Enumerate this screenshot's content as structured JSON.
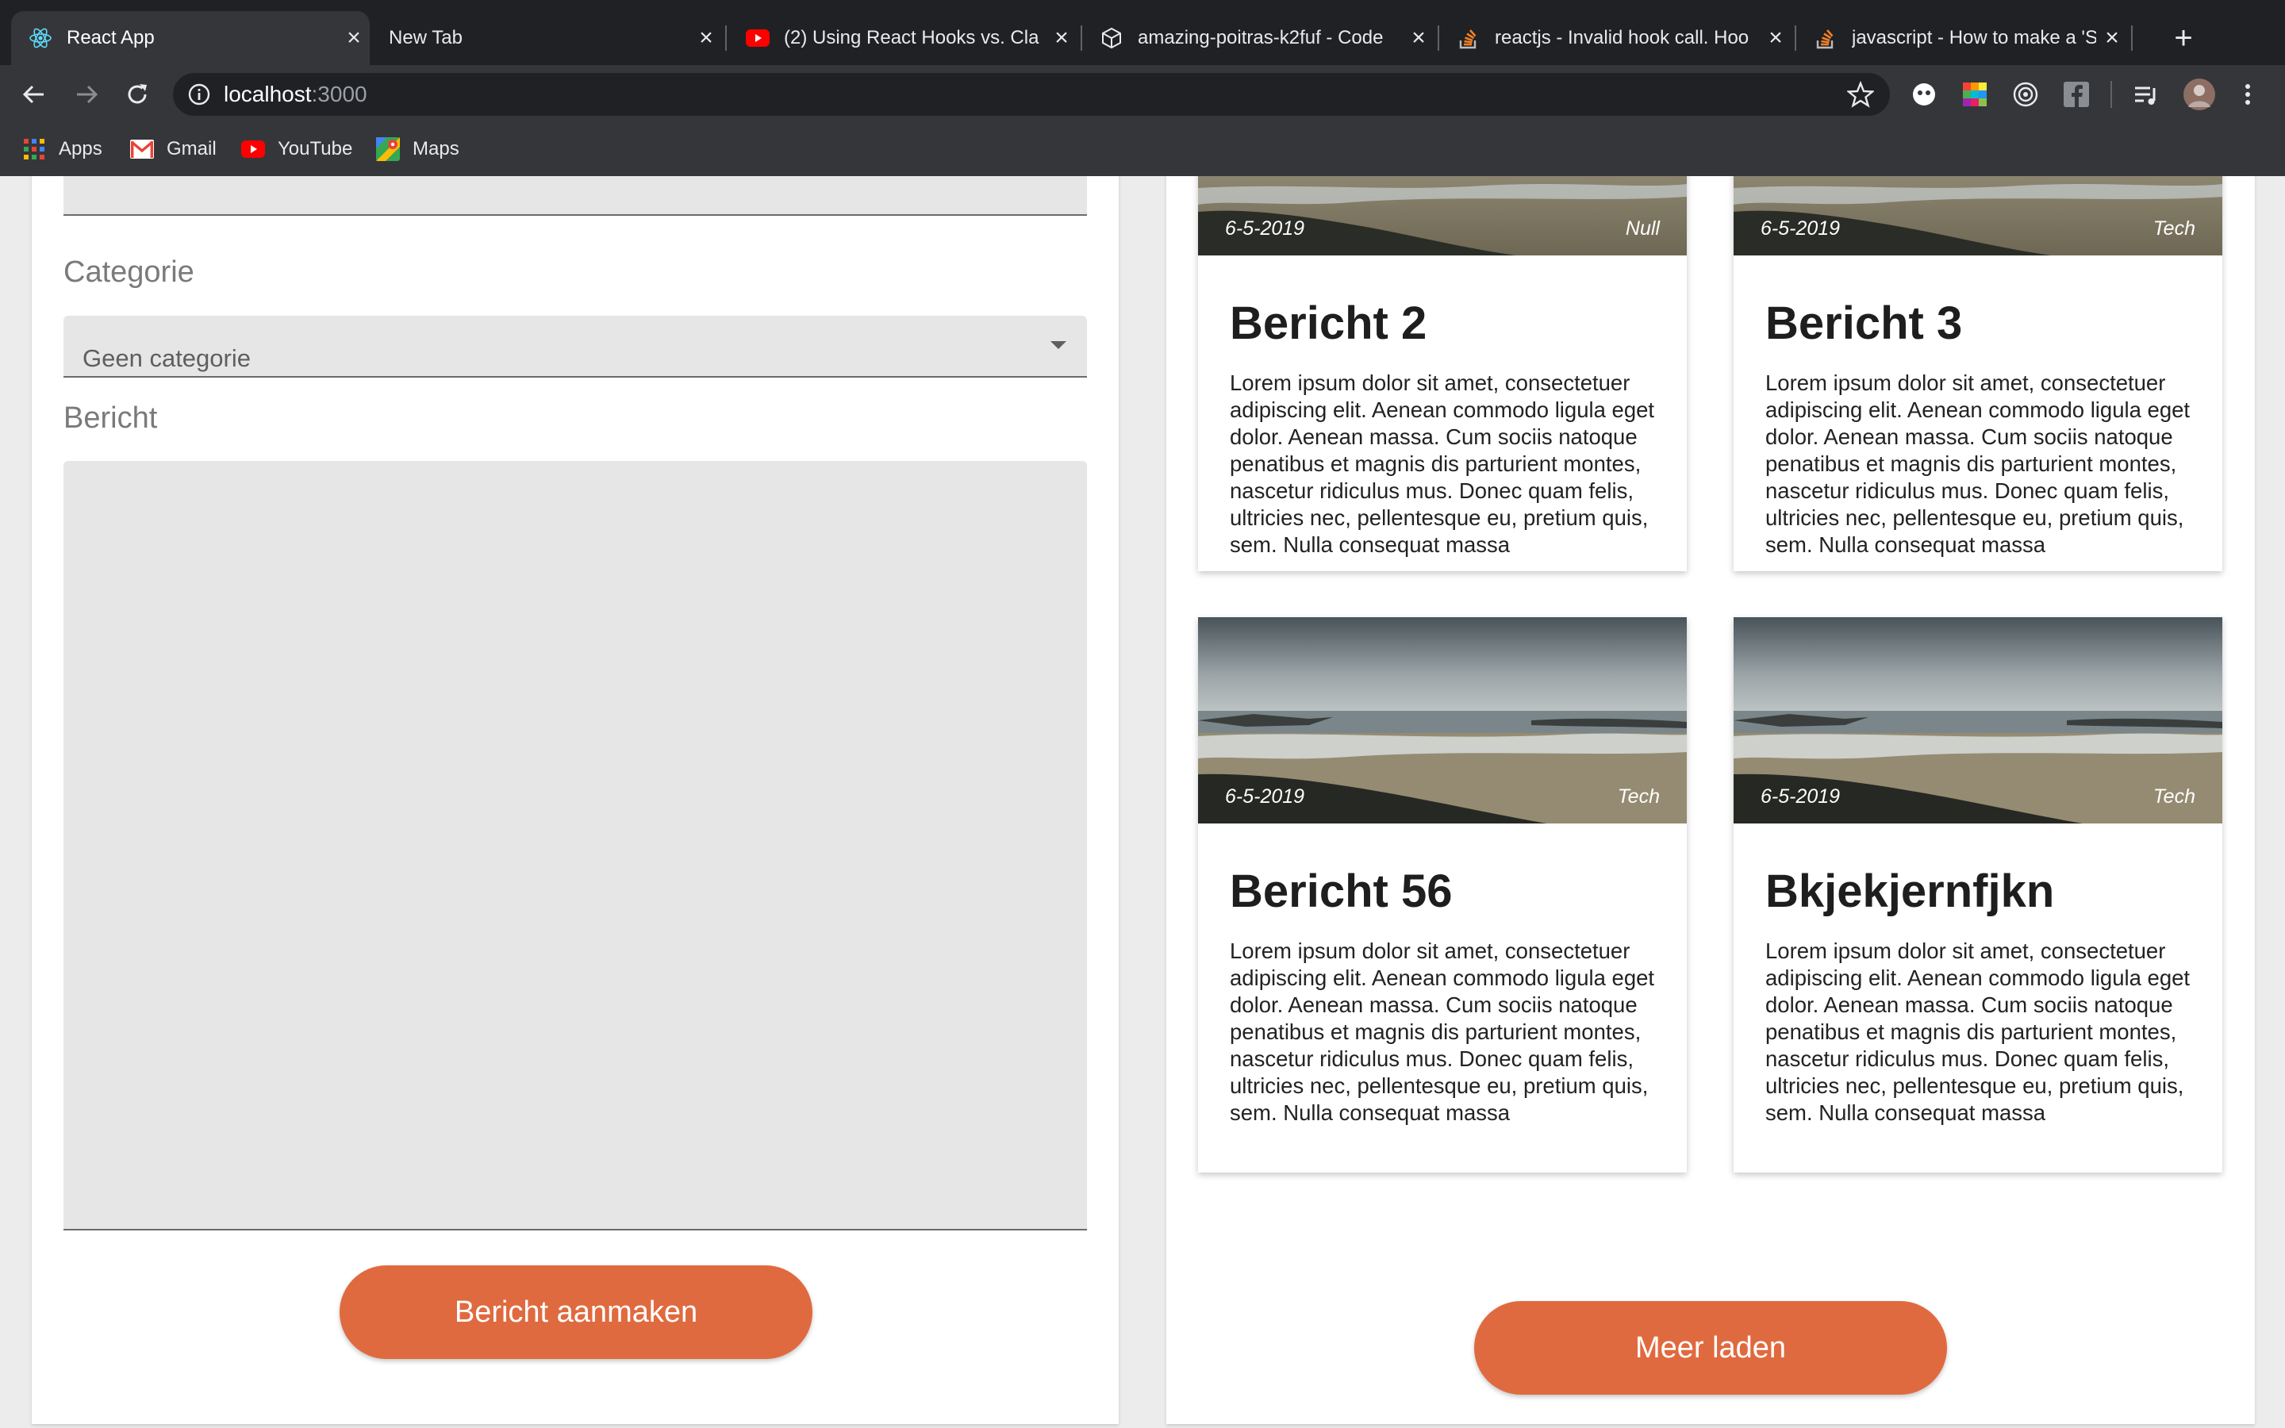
{
  "browser": {
    "tabs": [
      {
        "title": "React App",
        "icon": "react-icon",
        "active": true
      },
      {
        "title": "New Tab",
        "icon": "",
        "active": false
      },
      {
        "title": "(2) Using React Hooks vs. Cla",
        "icon": "youtube-icon",
        "active": false
      },
      {
        "title": "amazing-poitras-k2fuf - Code",
        "icon": "codesandbox-icon",
        "active": false
      },
      {
        "title": "reactjs - Invalid hook call. Hoo",
        "icon": "stackoverflow-icon",
        "active": false
      },
      {
        "title": "javascript - How to make a 'Se",
        "icon": "stackoverflow-icon",
        "active": false
      }
    ],
    "url": {
      "host": "localhost",
      "port": ":3000"
    },
    "bookmarks": [
      {
        "label": "Apps",
        "icon": "apps-grid-icon"
      },
      {
        "label": "Gmail",
        "icon": "gmail-icon"
      },
      {
        "label": "YouTube",
        "icon": "youtube-icon"
      },
      {
        "label": "Maps",
        "icon": "maps-icon"
      }
    ]
  },
  "form": {
    "category_label": "Categorie",
    "category_value": "Geen categorie",
    "message_label": "Bericht",
    "message_value": "",
    "submit_label": "Bericht aanmaken"
  },
  "posts": [
    {
      "title": "Bericht 2",
      "date": "6-5-2019",
      "category": "Null",
      "body": "Lorem ipsum dolor sit amet, consectetuer adipiscing elit. Aenean commodo ligula eget dolor. Aenean massa. Cum sociis natoque penatibus et magnis dis parturient montes, nascetur ridiculus mus. Donec quam felis, ultricies nec, pellentesque eu, pretium quis, sem. Nulla consequat massa"
    },
    {
      "title": "Bericht 3",
      "date": "6-5-2019",
      "category": "Tech",
      "body": "Lorem ipsum dolor sit amet, consectetuer adipiscing elit. Aenean commodo ligula eget dolor. Aenean massa. Cum sociis natoque penatibus et magnis dis parturient montes, nascetur ridiculus mus. Donec quam felis, ultricies nec, pellentesque eu, pretium quis, sem. Nulla consequat massa"
    },
    {
      "title": "Bericht 56",
      "date": "6-5-2019",
      "category": "Tech",
      "body": "Lorem ipsum dolor sit amet, consectetuer adipiscing elit. Aenean commodo ligula eget dolor. Aenean massa. Cum sociis natoque penatibus et magnis dis parturient montes, nascetur ridiculus mus. Donec quam felis, ultricies nec, pellentesque eu, pretium quis, sem. Nulla consequat massa"
    },
    {
      "title": "Bkjekjernfjkn",
      "date": "6-5-2019",
      "category": "Tech",
      "body": "Lorem ipsum dolor sit amet, consectetuer adipiscing elit. Aenean commodo ligula eget dolor. Aenean massa. Cum sociis natoque penatibus et magnis dis parturient montes, nascetur ridiculus mus. Donec quam felis, ultricies nec, pellentesque eu, pretium quis, sem. Nulla consequat massa"
    }
  ],
  "load_more_label": "Meer laden",
  "colors": {
    "accent": "#e06a3f",
    "chrome_dark": "#202124",
    "chrome": "#35363a"
  }
}
